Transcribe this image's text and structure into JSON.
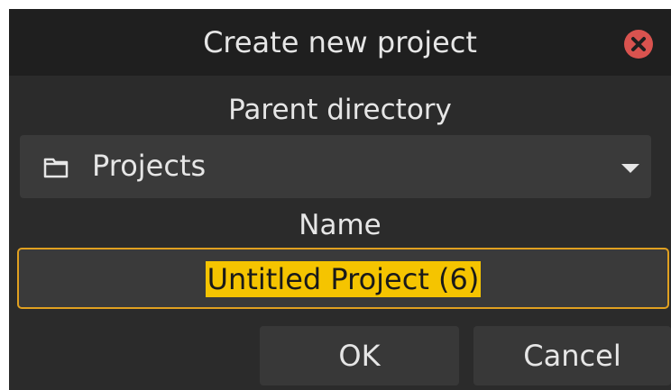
{
  "dialog": {
    "title": "Create new project",
    "parent_directory_label": "Parent directory",
    "parent_directory_value": "Projects",
    "name_label": "Name",
    "name_value": "Untitled Project (6)",
    "ok_label": "OK",
    "cancel_label": "Cancel"
  },
  "icons": {
    "close": "close-icon",
    "folder": "folder-icon",
    "dropdown": "chevron-down-icon"
  },
  "colors": {
    "close_button": "#d9534f",
    "focus_border": "#e0a020",
    "selection_highlight": "#f5c400"
  }
}
